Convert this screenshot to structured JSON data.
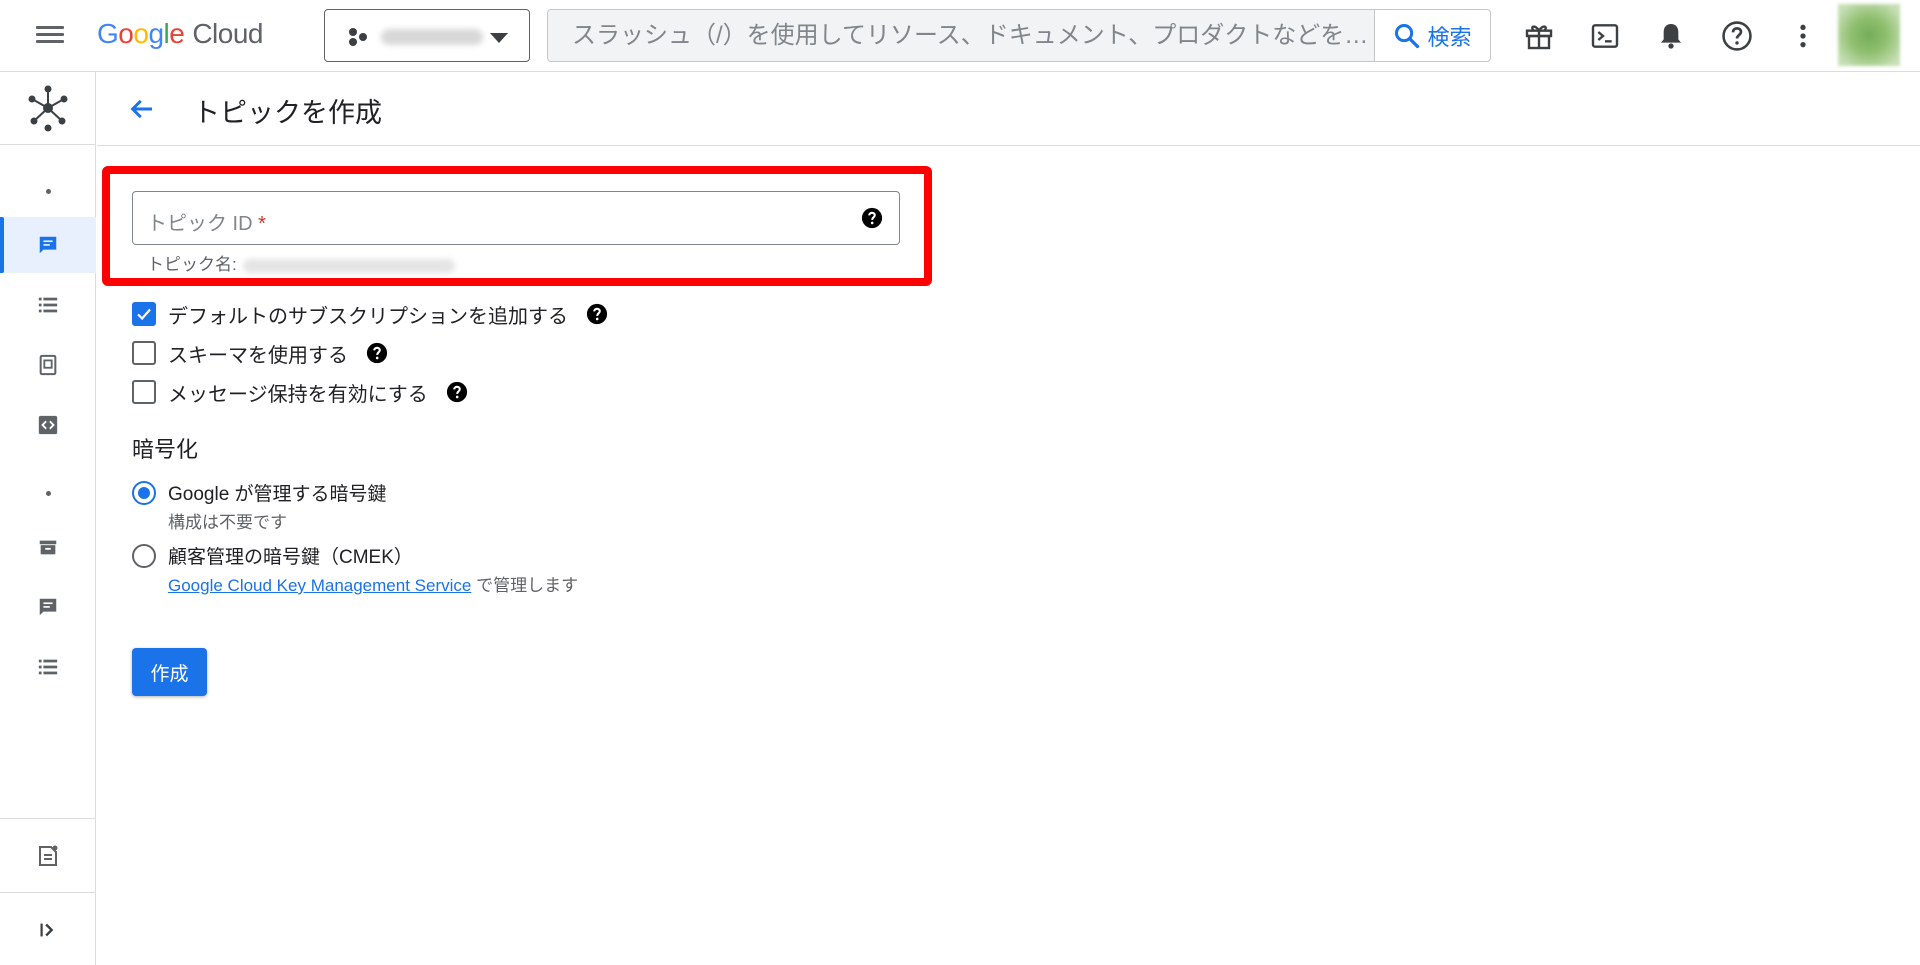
{
  "app": {
    "logo_google": [
      "G",
      "o",
      "o",
      "g",
      "l",
      "e"
    ],
    "logo_cloud": "Cloud"
  },
  "search": {
    "placeholder": "スラッシュ（/）を使用してリソース、ドキュメント、プロダクトなどを…",
    "button_label": "検索"
  },
  "page": {
    "title": "トピックを作成"
  },
  "form": {
    "topic_id_label": "トピック ID",
    "required_mark": "*",
    "topic_name_label": "トピック名:",
    "checkboxes": [
      {
        "label": "デフォルトのサブスクリプションを追加する",
        "checked": true
      },
      {
        "label": "スキーマを使用する",
        "checked": false
      },
      {
        "label": "メッセージ保持を有効にする",
        "checked": false
      }
    ],
    "encryption": {
      "title": "暗号化",
      "options": [
        {
          "label": "Google が管理する暗号鍵",
          "sub": "構成は不要です",
          "selected": true
        },
        {
          "label": "顧客管理の暗号鍵（CMEK）",
          "link": "Google Cloud Key Management Service",
          "sub_suffix": "で管理します",
          "selected": false
        }
      ]
    },
    "create_button": "作成"
  },
  "colors": {
    "accent": "#1a73e8",
    "highlight": "#ff0000",
    "required": "#d93025"
  }
}
